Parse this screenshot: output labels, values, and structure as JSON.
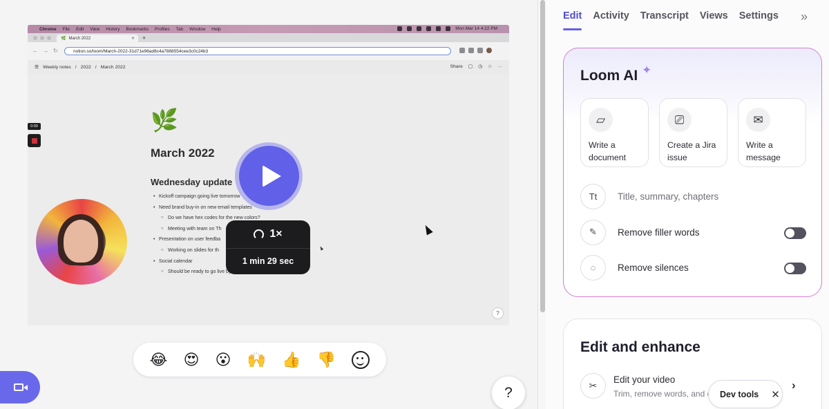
{
  "browser": {
    "menubar": {
      "app": "Chrome",
      "items": [
        "File",
        "Edit",
        "View",
        "History",
        "Bookmarks",
        "Profiles",
        "Tab",
        "Window",
        "Help"
      ],
      "datetime": "Mon Mar 14  4:22 PM"
    },
    "tab_title": "March 2022",
    "url": "notion.so/loom/March-2022-31d71e96ad8c4a7888554cee3c0c24b3",
    "breadcrumbs": [
      "Weekly notes",
      "2022",
      "March 2022"
    ],
    "share_label": "Share"
  },
  "notion": {
    "title": "March 2022",
    "heading": "Wednesday update",
    "bullets": [
      {
        "level": 1,
        "text": "Kickoff campaign going live tomorrow"
      },
      {
        "level": 1,
        "text": "Need brand buy-in on new email templates"
      },
      {
        "level": 2,
        "text": "Do we have hex codes for the new colors?"
      },
      {
        "level": 2,
        "text": "Meeting with team on Th"
      },
      {
        "level": 1,
        "text": "Presentation on user feedba"
      },
      {
        "level": 2,
        "text": "Working on slides for th"
      },
      {
        "level": 1,
        "text": "Social calendar"
      },
      {
        "level": 2,
        "text": "Should be ready to go live by"
      }
    ],
    "help_label": "?"
  },
  "recording": {
    "timer": "0:00"
  },
  "player": {
    "speed": "1×",
    "duration": "1 min 29 sec"
  },
  "reactions": [
    "😂",
    "😍",
    "😮",
    "🙌",
    "👍",
    "👎"
  ],
  "help_fab": "?",
  "panel": {
    "tabs": [
      "Edit",
      "Activity",
      "Transcript",
      "Views",
      "Settings"
    ],
    "active_tab": "Edit",
    "collapse_icon": "»",
    "loom_ai": {
      "title": "Loom AI",
      "actions": [
        {
          "label": "Write a document",
          "icon": "document-plus-icon"
        },
        {
          "label": "Create a Jira issue",
          "icon": "ticket-plus-icon"
        },
        {
          "label": "Write a message",
          "icon": "envelope-plus-icon"
        }
      ],
      "options": [
        {
          "label": "Title, summary, chapters",
          "icon": "text-sparkle-icon"
        },
        {
          "label": "Remove filler words",
          "icon": "magic-wand-icon",
          "toggle": false
        },
        {
          "label": "Remove silences",
          "icon": "dashed-circle-icon",
          "toggle": false
        }
      ]
    },
    "edit_enhance": {
      "title": "Edit and enhance",
      "edit_video_title": "Edit your video",
      "edit_video_desc": "Trim, remove words, and c"
    }
  },
  "devtools": {
    "label": "Dev tools",
    "close": "✕"
  },
  "colors": {
    "accent": "#6160e8",
    "ai_border": "#d07fcf",
    "toggle_off": "#53525e"
  }
}
